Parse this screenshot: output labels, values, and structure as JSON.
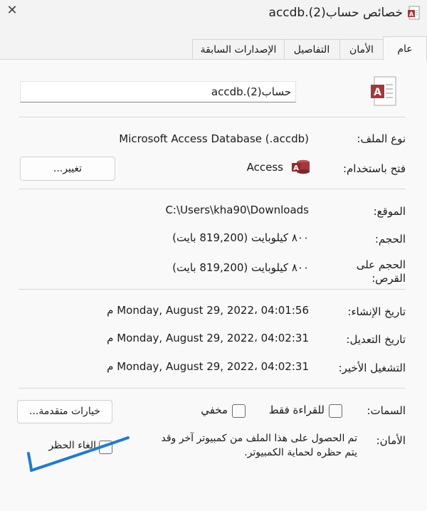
{
  "window": {
    "title": "خصائص حساب(2).accdb",
    "icon": "access-file-icon",
    "close_glyph": "✕"
  },
  "tabs": [
    {
      "label": "عام",
      "active": true
    },
    {
      "label": "الأمان",
      "active": false
    },
    {
      "label": "التفاصيل",
      "active": false
    },
    {
      "label": "الإصدارات السابقة",
      "active": false
    }
  ],
  "general": {
    "file_name": "حساب(2).accdb",
    "file_type_label": "نوع الملف:",
    "file_type_value": "Microsoft Access Database (.accdb)",
    "opens_with_label": "فتح باستخدام:",
    "opens_with_value": "Access",
    "change_button": "تغيير...",
    "location_label": "الموقع:",
    "location_value": "C:\\Users\\kha90\\Downloads",
    "size_label": "الحجم:",
    "size_value": "٨٠٠ كيلوبايت (819,200 بايت)",
    "size_on_disk_label": "الحجم على القرص:",
    "size_on_disk_value": "٨٠٠ كيلوبايت (819,200 بايت)",
    "created_label": "تاريخ الإنشاء:",
    "created_value": "Monday, August 29, 2022، 04:01:56 م",
    "modified_label": "تاريخ التعديل:",
    "modified_value": "Monday, August 29, 2022، 04:02:31 م",
    "accessed_label": "التشغيل الأخير:",
    "accessed_value": "Monday, August 29, 2022، 04:02:31 م",
    "attributes_label": "السمات:",
    "readonly_label": "للقراءة فقط",
    "hidden_label": "مخفي",
    "advanced_button": "خيارات متقدمة...",
    "security_label": "الأمان:",
    "security_text_1": "تم الحصول على هذا الملف من كمبيوتر آخر وقد",
    "security_text_2": "يتم حظره لحماية الكمبيوتر.",
    "unblock_label": "إلغاء الحظر"
  },
  "colors": {
    "access_red": "#a4373a",
    "annotation_blue": "#1f7ad1"
  }
}
